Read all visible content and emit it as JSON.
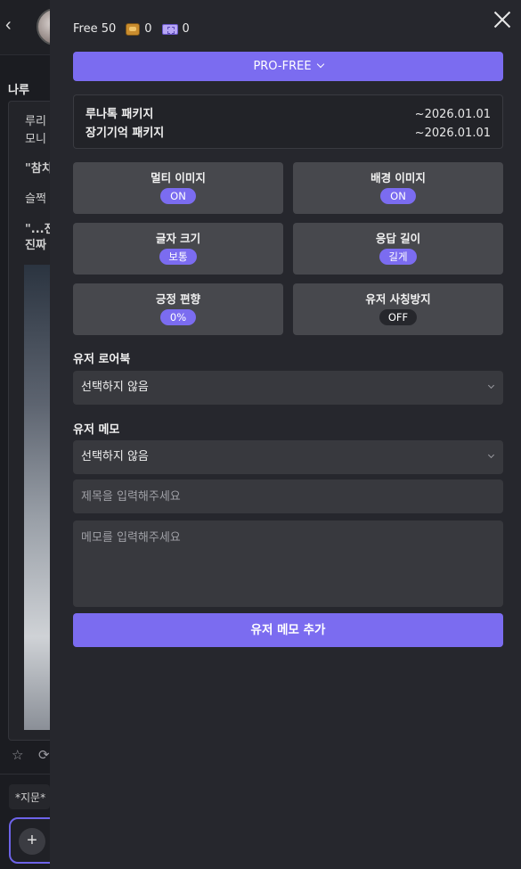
{
  "background": {
    "back_icon": "chevron-left-icon",
    "character_name": "나루",
    "lines": [
      "루리",
      "모니",
      "\"참치",
      "슬쩍",
      "\"...전",
      "진짜"
    ],
    "hint": "*지문*"
  },
  "drawer": {
    "credits": {
      "free_label": "Free 50",
      "coin_count": "0",
      "ticket_count": "0"
    },
    "plan_button": "PRO-FREE",
    "packages": [
      {
        "name": "루나톡 패키지",
        "expiry": "~2026.01.01"
      },
      {
        "name": "장기기억 패키지",
        "expiry": "~2026.01.01"
      }
    ],
    "settings": [
      {
        "label": "멀티 이미지",
        "value": "ON"
      },
      {
        "label": "배경 이미지",
        "value": "ON"
      },
      {
        "label": "글자 크기",
        "value": "보통"
      },
      {
        "label": "응답 길이",
        "value": "길게"
      },
      {
        "label": "긍정 편향",
        "value": "0%"
      },
      {
        "label": "유저 사칭방지",
        "value": "OFF"
      }
    ],
    "lorebook": {
      "title": "유저 로어북",
      "selected": "선택하지 않음"
    },
    "memo": {
      "title": "유저 메모",
      "selected": "선택하지 않음",
      "title_placeholder": "제목을 입력해주세요",
      "body_placeholder": "메모를 입력해주세요",
      "add_button": "유저 메모 추가"
    },
    "colors": {
      "accent": "#7b6cf0",
      "panel": "#26272d",
      "tile": "#47484d",
      "field": "#38393e"
    }
  }
}
